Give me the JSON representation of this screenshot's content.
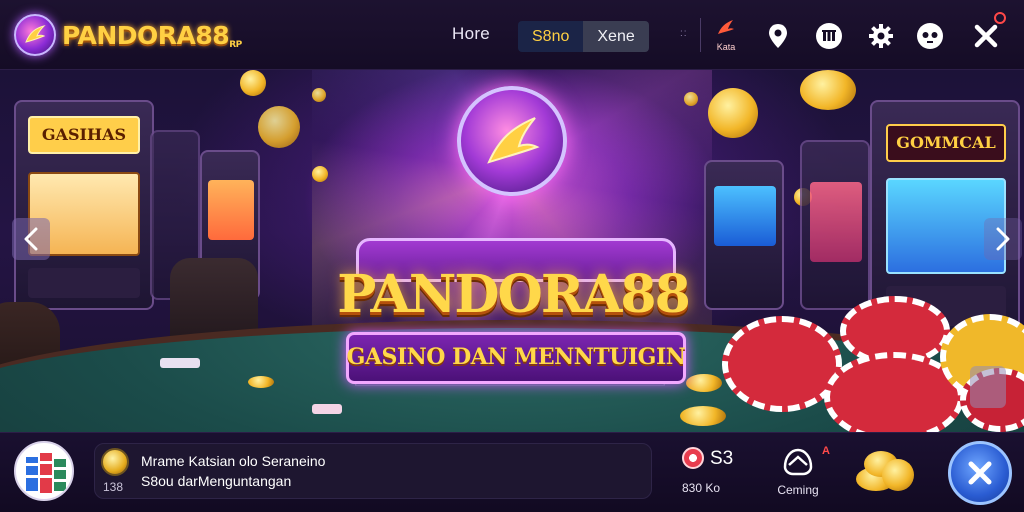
{
  "header": {
    "logo_text": "PANDORA88",
    "logo_suffix": "RP",
    "nav_home": "Hore",
    "segment": {
      "active_label": "S8no",
      "inactive_label": "Xene"
    },
    "dots": "::",
    "kata_label": "Kata",
    "icons": [
      "location-pin-icon",
      "wallet-icon",
      "gear-icon",
      "face-icon",
      "close-icon"
    ]
  },
  "hero": {
    "brand": "PANDORA88",
    "tagline": "GASINO DAN MENNTUIGIN",
    "left_machine_sign": "GASIHAS",
    "right_machine_sign": "GOMMCAL"
  },
  "footer": {
    "message": {
      "time": "138",
      "line1": "Mrame Katsian olo Seraneino",
      "line2": "S8ou darMenguntangan"
    },
    "stat": {
      "value": "S3",
      "sub": "830  Ko"
    },
    "gaming": {
      "label": "Ceming",
      "badge": "A"
    }
  },
  "colors": {
    "brand_gold": "#ffd043",
    "bg_dark": "#150c26",
    "accent_purple": "#a23ad1",
    "close_blue": "#2a5cd2",
    "alert_red": "#ff4848"
  }
}
